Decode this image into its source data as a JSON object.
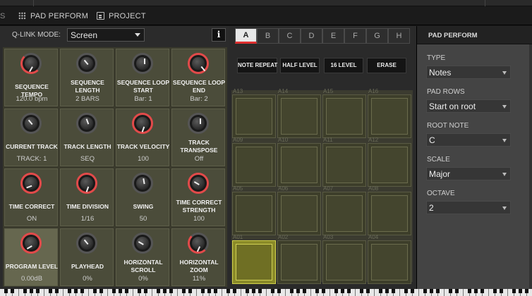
{
  "tabs": {
    "pad_perform": "PAD PERFORM",
    "project": "PROJECT",
    "left_glyph": "S"
  },
  "qlink": {
    "label": "Q-LINK MODE:",
    "mode": "Screen",
    "info": "i"
  },
  "knobs": [
    {
      "label": "SEQUENCE TEMPO",
      "value": "120.0 bpm",
      "accent": "red-partial"
    },
    {
      "label": "SEQUENCE LENGTH",
      "value": "2 BARS",
      "accent": "none"
    },
    {
      "label": "SEQUENCE LOOP START",
      "value": "Bar: 1",
      "accent": "none"
    },
    {
      "label": "SEQUENCE LOOP END",
      "value": "Bar: 2",
      "accent": "red"
    },
    {
      "label": "CURRENT TRACK",
      "value": "TRACK: 1",
      "accent": "none"
    },
    {
      "label": "TRACK LENGTH",
      "value": "SEQ",
      "accent": "none"
    },
    {
      "label": "TRACK VELOCITY",
      "value": "100",
      "accent": "red"
    },
    {
      "label": "TRACK TRANSPOSE",
      "value": "Off",
      "accent": "none"
    },
    {
      "label": "TIME CORRECT",
      "value": "ON",
      "accent": "red"
    },
    {
      "label": "TIME DIVISION",
      "value": "1/16",
      "accent": "red"
    },
    {
      "label": "SWING",
      "value": "50",
      "accent": "none"
    },
    {
      "label": "TIME CORRECT STRENGTH",
      "value": "100",
      "accent": "red"
    },
    {
      "label": "PROGRAM LEVEL",
      "value": "0.00dB",
      "accent": "red"
    },
    {
      "label": "PLAYHEAD",
      "value": "0%",
      "accent": "none"
    },
    {
      "label": "HORIZONTAL SCROLL",
      "value": "0%",
      "accent": "none"
    },
    {
      "label": "HORIZONTAL ZOOM",
      "value": "11%",
      "accent": "red-partial"
    }
  ],
  "pad_banks": [
    "A",
    "B",
    "C",
    "D",
    "E",
    "F",
    "G",
    "H"
  ],
  "selected_bank": "A",
  "function_buttons": [
    "NOTE REPEAT",
    "HALF LEVEL",
    "16 LEVEL",
    "ERASE"
  ],
  "pads": [
    [
      "A13",
      "A14",
      "A15",
      "A16"
    ],
    [
      "A09",
      "A10",
      "A11",
      "A12"
    ],
    [
      "A05",
      "A06",
      "A07",
      "A08"
    ],
    [
      "A01",
      "A02",
      "A03",
      "A04"
    ]
  ],
  "active_pad": "A01",
  "right_panel": {
    "title": "PAD PERFORM",
    "fields": [
      {
        "label": "TYPE",
        "value": "Notes"
      },
      {
        "label": "PAD ROWS",
        "value": "Start on root"
      },
      {
        "label": "ROOT NOTE",
        "value": "C"
      },
      {
        "label": "SCALE",
        "value": "Major"
      },
      {
        "label": "OCTAVE",
        "value": "2"
      }
    ]
  },
  "colors": {
    "accent_red": "#e24a4a",
    "pad_active": "#8a8a28",
    "knob_cell": "#4b4c3a"
  }
}
